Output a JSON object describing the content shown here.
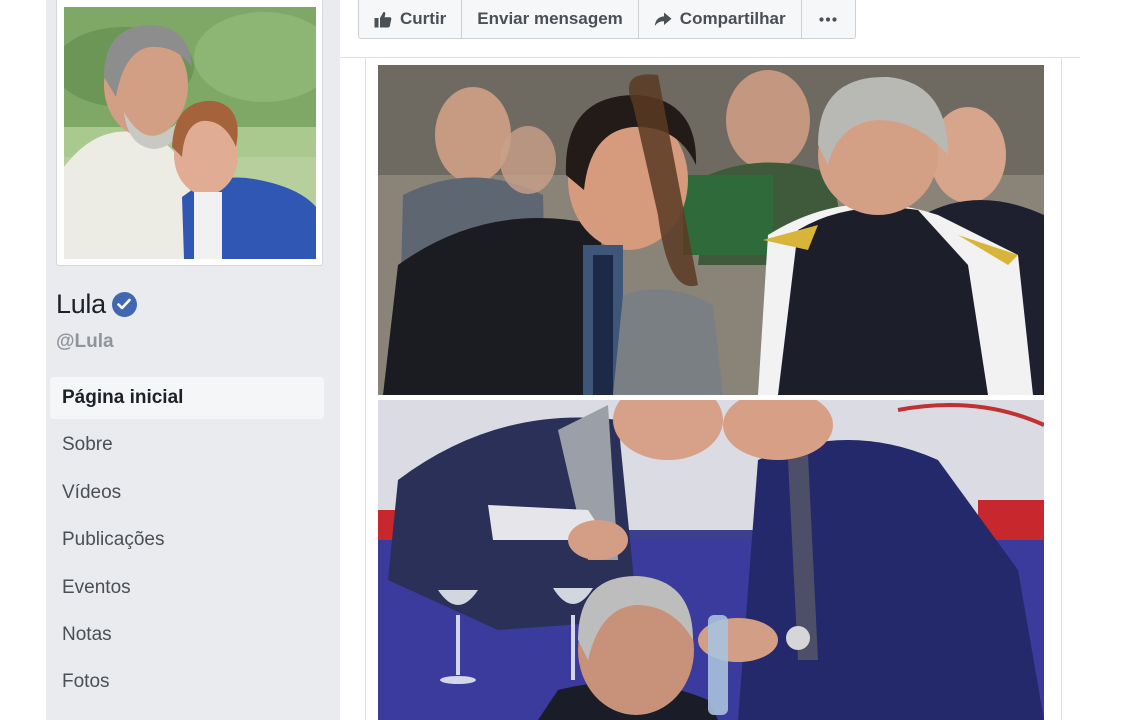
{
  "page": {
    "name": "Lula",
    "handle": "@Lula",
    "verified": true,
    "verified_color": "#4267b2"
  },
  "sidebar": {
    "items": [
      {
        "label": "Página inicial",
        "active": true
      },
      {
        "label": "Sobre"
      },
      {
        "label": "Vídeos"
      },
      {
        "label": "Publicações"
      },
      {
        "label": "Eventos"
      },
      {
        "label": "Notas"
      },
      {
        "label": "Fotos"
      }
    ]
  },
  "actions": {
    "like_label": "Curtir",
    "like_icon": "thumbs-up-icon",
    "message_label": "Enviar mensagem",
    "share_label": "Compartilhar",
    "share_icon": "share-arrow-icon",
    "more_icon": "more-dots-icon"
  },
  "colors": {
    "sidebar_bg": "#e9ebee",
    "text_muted": "#90949c",
    "button_bg": "#f6f7f9"
  }
}
